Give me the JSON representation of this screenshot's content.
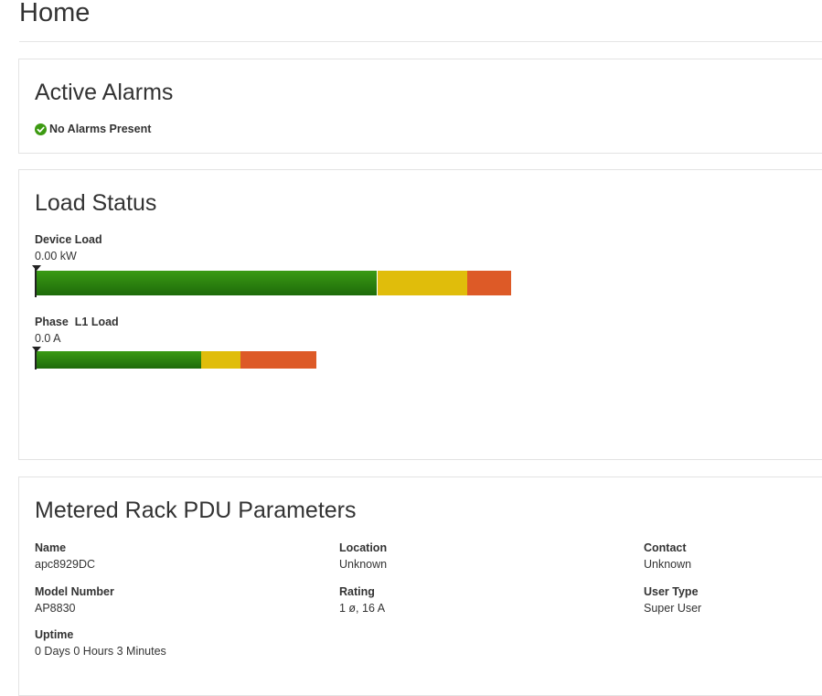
{
  "page": {
    "title": "Home"
  },
  "alarms": {
    "heading": "Active Alarms",
    "status_text": "No Alarms Present",
    "status_color": "#3d9a12"
  },
  "load_status": {
    "heading": "Load Status",
    "device": {
      "label": "Device Load",
      "value": "0.00 kW",
      "level": 0,
      "zones": {
        "green": 0.718,
        "yellow": 0.19,
        "red": 0.092
      }
    },
    "phase": {
      "label": "Phase  L1 Load",
      "value": "0.0 A",
      "level": 0,
      "zones": {
        "green": 0.59,
        "yellow": 0.14,
        "red": 0.27
      }
    },
    "colors": {
      "green": "#2a8010",
      "yellow": "#e0bd0b",
      "red": "#dd5a27"
    }
  },
  "params": {
    "heading": "Metered Rack PDU Parameters",
    "name": {
      "label": "Name",
      "value": "apc8929DC"
    },
    "location": {
      "label": "Location",
      "value": "Unknown"
    },
    "contact": {
      "label": "Contact",
      "value": "Unknown"
    },
    "model": {
      "label": "Model Number",
      "value": "AP8830"
    },
    "rating": {
      "label": "Rating",
      "value": "1 ø, 16 A"
    },
    "user_type": {
      "label": "User Type",
      "value": "Super User"
    },
    "uptime": {
      "label": "Uptime",
      "value": "0 Days 0 Hours 3 Minutes"
    }
  }
}
